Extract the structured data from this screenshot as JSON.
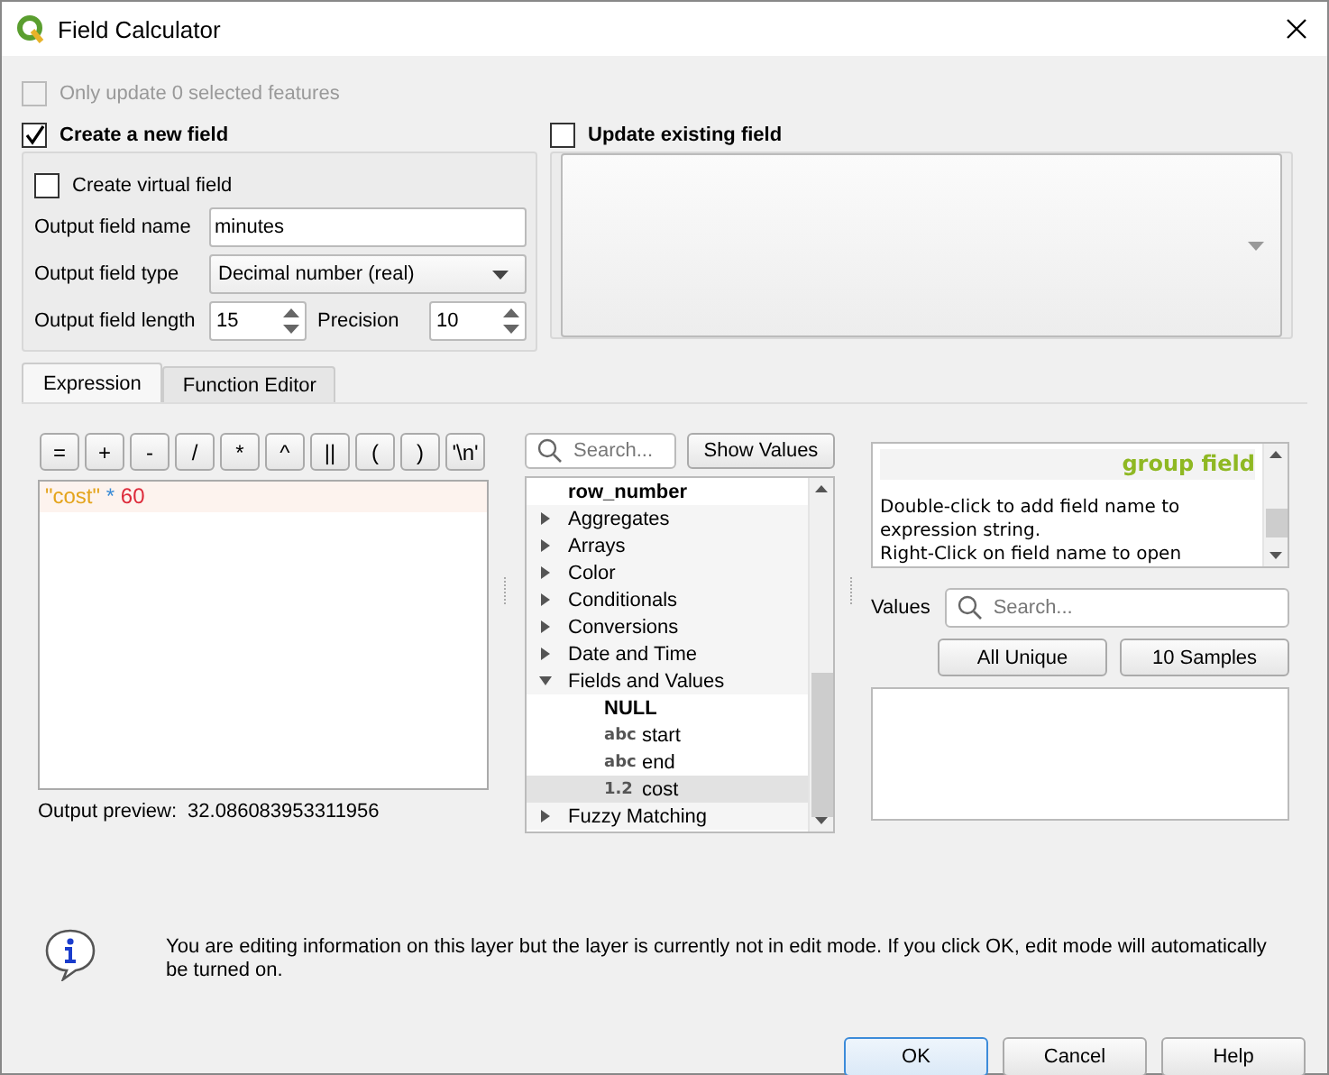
{
  "window": {
    "title": "Field Calculator"
  },
  "only_update": {
    "label": "Only update 0 selected features",
    "checked": false,
    "disabled": true
  },
  "create_new": {
    "label": "Create a new field",
    "checked": true,
    "virtual": {
      "label": "Create virtual field",
      "checked": false
    },
    "name": {
      "label": "Output field name",
      "value": "minutes"
    },
    "type": {
      "label": "Output field type",
      "value": "Decimal number (real)"
    },
    "length": {
      "label": "Output field length",
      "value": "15"
    },
    "precision": {
      "label": "Precision",
      "value": "10"
    }
  },
  "update_existing": {
    "label": "Update existing field",
    "checked": false
  },
  "tabs": [
    {
      "label": "Expression",
      "selected": true
    },
    {
      "label": "Function Editor",
      "selected": false
    }
  ],
  "operators": [
    "=",
    "+",
    "-",
    "/",
    "*",
    "^",
    "||",
    "(",
    ")",
    "'\\n'"
  ],
  "expression": [
    {
      "text": "\"cost\"",
      "kind": "field"
    },
    {
      "text": "*",
      "kind": "operator"
    },
    {
      "text": "60",
      "kind": "number"
    }
  ],
  "output_preview": {
    "label": "Output preview:",
    "value": "32.086083953311956"
  },
  "function_search": {
    "placeholder": "Search..."
  },
  "show_values": "Show Values",
  "tree": [
    {
      "label": "row_number",
      "bold": true,
      "selected": false
    },
    {
      "label": "Aggregates",
      "expanded": false,
      "selected": false
    },
    {
      "label": "Arrays",
      "expanded": false,
      "selected": false
    },
    {
      "label": "Color",
      "expanded": false,
      "selected": false
    },
    {
      "label": "Conditionals",
      "expanded": false,
      "selected": false
    },
    {
      "label": "Conversions",
      "expanded": false,
      "selected": false
    },
    {
      "label": "Date and Time",
      "expanded": false,
      "selected": false
    },
    {
      "label": "Fields and Values",
      "expanded": true,
      "selected": false,
      "children": [
        {
          "label": "NULL",
          "bold": true,
          "selected": false
        },
        {
          "label": "start",
          "badge": "abc",
          "selected": false
        },
        {
          "label": "end",
          "badge": "abc",
          "selected": false
        },
        {
          "label": "cost",
          "badge": "1.2",
          "selected": true
        }
      ]
    },
    {
      "label": "Fuzzy Matching",
      "expanded": false,
      "selected": false
    }
  ],
  "help": {
    "title": "group field",
    "lines": [
      "Double-click to add field name to expression string.",
      "Right-Click on field name to open"
    ]
  },
  "values": {
    "label": "Values",
    "placeholder": "Search...",
    "buttons": [
      "All Unique",
      "10 Samples"
    ]
  },
  "message": "You are editing information on this layer but the layer is currently not in edit mode. If you click OK, edit mode will automatically be turned on.",
  "buttons": [
    {
      "label": "OK",
      "default": true
    },
    {
      "label": "Cancel",
      "default": false
    },
    {
      "label": "Help",
      "default": false
    }
  ]
}
